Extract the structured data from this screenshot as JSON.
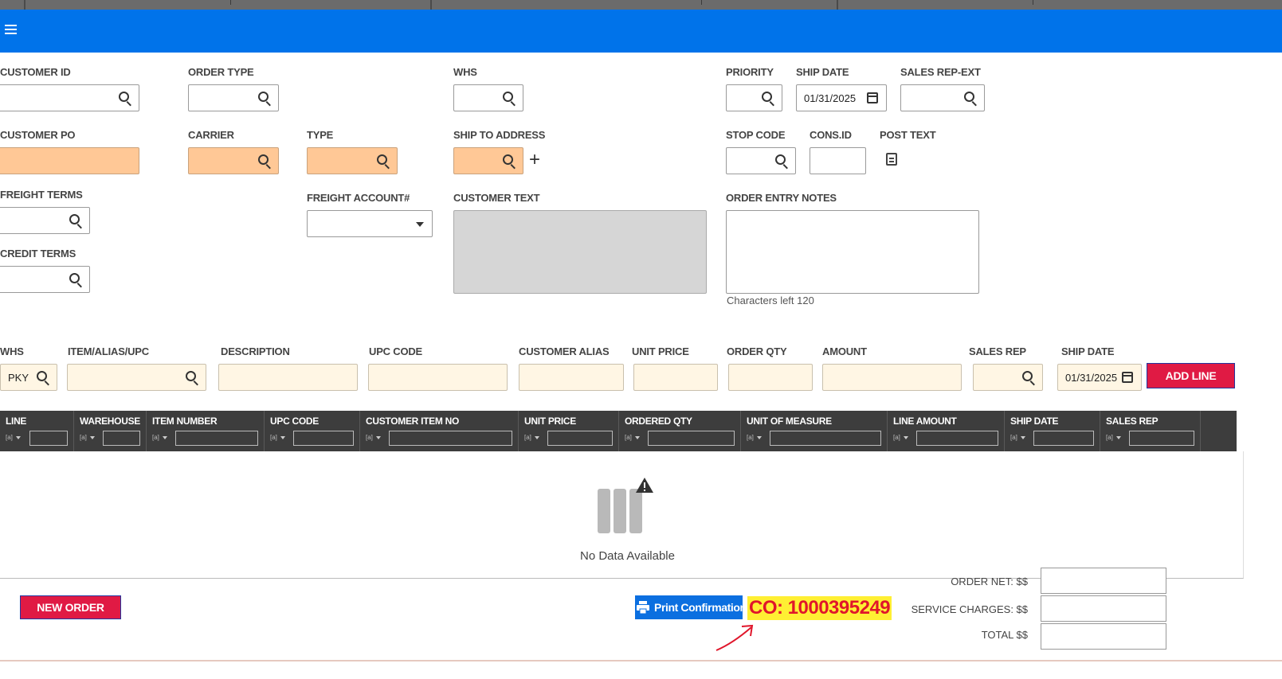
{
  "header": {
    "menu_icon": "hamburger-menu-icon",
    "accent": "#0073ea"
  },
  "order": {
    "customer_id_label": "CUSTOMER ID",
    "order_type_label": "ORDER TYPE",
    "whs_label": "WHS",
    "priority_label": "PRIORITY",
    "ship_date_label": "SHIP DATE",
    "ship_date_value": "01/31/2025",
    "sales_rep_ext_label": "SALES REP-EXT",
    "customer_po_label": "CUSTOMER PO",
    "carrier_label": "CARRIER",
    "type_label": "TYPE",
    "ship_to_label": "SHIP TO ADDRESS",
    "stop_code_label": "STOP CODE",
    "cons_id_label": "CONS.ID",
    "post_text_label": "POST TEXT",
    "freight_terms_label": "FREIGHT TERMS",
    "freight_account_label": "FREIGHT ACCOUNT#",
    "customer_text_label": "CUSTOMER TEXT",
    "order_entry_notes_label": "ORDER ENTRY NOTES",
    "chars_left": "Characters left 120",
    "credit_terms_label": "CREDIT TERMS"
  },
  "line_entry": {
    "whs_label": "WHS",
    "whs_value": "PKY",
    "item_label": "ITEM/ALIAS/UPC",
    "description_label": "DESCRIPTION",
    "upc_label": "UPC CODE",
    "customer_alias_label": "CUSTOMER ALIAS",
    "unit_price_label": "UNIT PRICE",
    "order_qty_label": "ORDER QTY",
    "amount_label": "AMOUNT",
    "sales_rep_label": "SALES REP",
    "ship_date_label": "SHIP DATE",
    "ship_date_value": "01/31/2025",
    "add_line_label": "ADD LINE"
  },
  "grid": {
    "columns": [
      "LINE",
      "WAREHOUSE",
      "ITEM NUMBER",
      "UPC CODE",
      "CUSTOMER ITEM NO",
      "UNIT PRICE",
      "ORDERED QTY",
      "UNIT OF MEASURE",
      "LINE AMOUNT",
      "SHIP DATE",
      "SALES REP"
    ],
    "filter_glyph": "[a]",
    "empty_text": "No Data Available"
  },
  "footer": {
    "new_order_label": "NEW ORDER",
    "print_label": "Print Confirmation",
    "co_text": "CO: 1000395249",
    "order_net_label": "ORDER NET: $$",
    "service_charges_label": "SERVICE CHARGES: $$",
    "total_label": "TOTAL $$"
  },
  "colors": {
    "required_field": "#ffc896",
    "line_field": "#fff6e4",
    "button_red": "#e01a44",
    "grid_header": "#3d3d3d"
  }
}
